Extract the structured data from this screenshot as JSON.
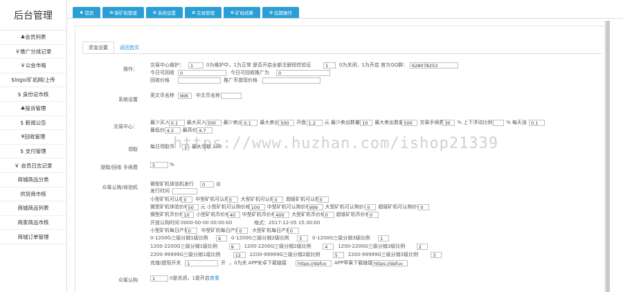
{
  "brand": "后台管理",
  "sidebar": [
    "♣会员列表",
    "￥推广分成记录",
    "￥公会市格",
    "$logo/矿机网/上传",
    "$ 身份证市核",
    "♣投诉管理",
    "$ 新闻公告",
    "¥回收管理",
    "$ 支付管理",
    "￥ 会员日志记录",
    "商城商品分类",
    "供货商市核",
    "商城商品列表",
    "商家商品市核",
    "商城订单管理"
  ],
  "topnav": [
    {
      "icon": "♣",
      "label": "首页"
    },
    {
      "icon": "✿",
      "label": "新矿机管理"
    },
    {
      "icon": "✿",
      "label": "系统设置"
    },
    {
      "icon": "✿",
      "label": "交易管理"
    },
    {
      "icon": "✿",
      "label": "矿机结算"
    },
    {
      "icon": "✿",
      "label": "后期操作"
    }
  ],
  "subtabs": [
    "奖金设置",
    "返回首页"
  ],
  "sec": {
    "op": "操作：",
    "sys": "系统设置",
    "trade": "交易中心：",
    "jinbi": "领取",
    "fee": "提取/回收 手续费",
    "crowd": "众筹认购/体验机",
    "crowd2": "众筹认购"
  },
  "op": {
    "t1": "交易中心维护：",
    "v1": "1",
    "t2": "0为维护中，1为正常 是否开启全部注册短信验证",
    "v2": "1",
    "t3": "0为关闭，1为开启 官方QQ群：",
    "v3": "628078253",
    "t4": "今日可回收",
    "v4": "0",
    "t5": "今日可回收推广为",
    "v5": "0",
    "t6": "回收价格",
    "t7": "推广币提现价格"
  },
  "sys": {
    "t1": "英文币名称",
    "v1": "MIR",
    "t2": "中文币名称"
  },
  "trade": {
    "r1": [
      [
        "最少买入",
        "0.1"
      ],
      [
        "最大买入",
        "500"
      ],
      [
        "最少卖出",
        "0.1"
      ],
      [
        "最大卖出",
        "500"
      ],
      [
        "开盘",
        "1.2"
      ],
      [
        "元 最少卖出数量",
        "10"
      ],
      [
        "最大卖出数量",
        "500"
      ],
      [
        "交易手续费",
        "30"
      ],
      [
        "% 上下浮动比例",
        ""
      ],
      [
        "% 每天涨",
        "0.1"
      ]
    ],
    "r2": [
      [
        "最低价",
        "4.3"
      ],
      [
        "最高价",
        "4.7"
      ]
    ]
  },
  "jinbi": {
    "t1": "每日领取币",
    "v1": "1",
    "t2": "最大领取",
    "v2": "200"
  },
  "fee": {
    "v": "5",
    "u": "%"
  },
  "crowd": {
    "a1": "微型矿机体验机发行",
    "v1": "0",
    "u1": "台",
    "a2": "发行时间",
    "b": [
      [
        "小型矿机可认购",
        "0"
      ],
      [
        "中型矿机可认购",
        "0"
      ],
      [
        "大型矿机可认购",
        "0"
      ],
      [
        "超级矿机可认购",
        "0"
      ]
    ],
    "c": [
      [
        "微型矿机体验价格",
        "50"
      ],
      [
        "元 小型矿机可认购价格",
        "100"
      ],
      [
        "中型矿机可认购价格",
        "999"
      ],
      [
        "大型矿机可认购价格",
        "0"
      ],
      [
        "超级矿机可认购价格",
        "0"
      ]
    ],
    "d": [
      [
        "微型矿机币价格",
        "10"
      ],
      [
        "小型矿机币价格",
        "40"
      ],
      [
        "中型矿机币价格",
        "400"
      ],
      [
        "大型矿机币价格",
        "0"
      ],
      [
        "超级矿机币价格",
        "0"
      ]
    ],
    "e": [
      "开放认购时间",
      "0000-00-00 00:00:00",
      "格式：2017-12-05 15:30:00"
    ],
    "f": [
      [
        "小型矿机每日产量",
        "0"
      ],
      [
        "中型矿机每日产量",
        "0"
      ],
      [
        "大型矿机每日产量",
        "0"
      ]
    ],
    "g": [
      [
        "0-1200G三级分销1级比例",
        "6"
      ],
      [
        "0-1200G三级分销2级比例",
        "3"
      ],
      [
        "0-1200G三级分销3级比例",
        "1"
      ]
    ],
    "h": [
      [
        "1200-2200G三级分销1级比例",
        "9"
      ],
      [
        "1200-2200G三级分销2级比例",
        "4"
      ],
      [
        "1200-2200G三级分销3级比例",
        "2"
      ]
    ],
    "i": [
      [
        "2200-99999G三级分销1级比例",
        "12"
      ],
      [
        "2200-99999G三级分销2级比例",
        "5"
      ],
      [
        "2200-99999G三级分销3级比例",
        "3"
      ]
    ],
    "j": [
      "充值/提现开关",
      "1",
      "开",
      "，0为关 APP安卓下载链接",
      "https://dafuv",
      "APP苹果下载链接",
      "https://dafuv"
    ]
  },
  "crowd2": {
    "v": "1",
    "t": "0是关闭，1是开启",
    "link": "查看"
  },
  "watermark": "https://www.huzhan.com/ishop21339"
}
